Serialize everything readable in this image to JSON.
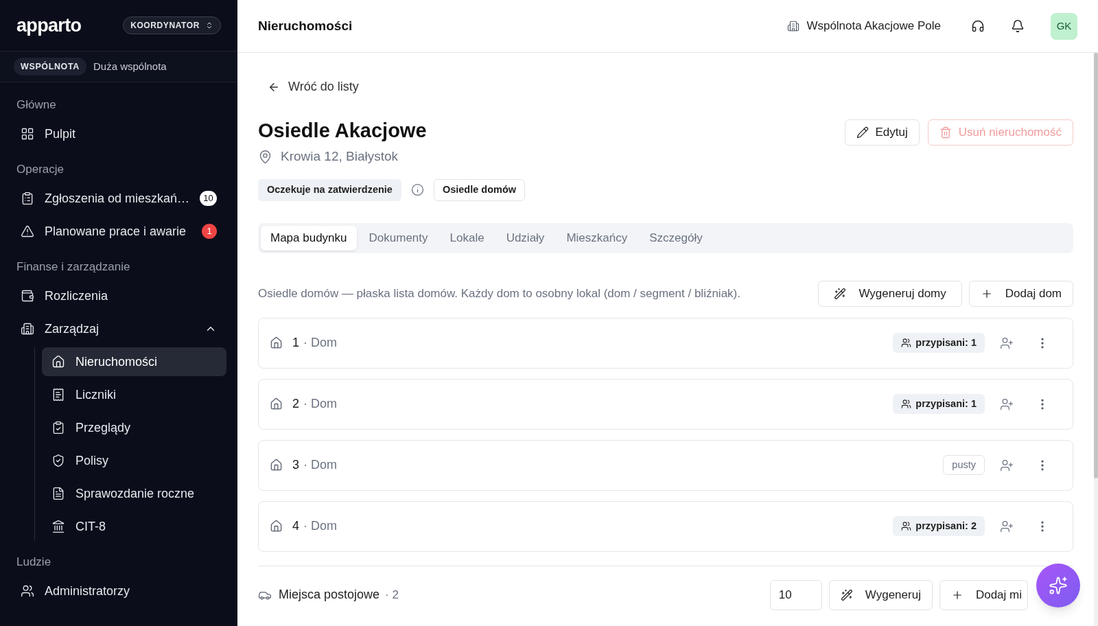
{
  "sidebar": {
    "logo": "apparto",
    "role": "KOORDYNATOR",
    "community_tag": "WSPÓLNOTA",
    "community_name": "Duża wspólnota",
    "sections": [
      {
        "title": "Główne",
        "items": [
          {
            "label": "Pulpit",
            "selected": false
          }
        ]
      },
      {
        "title": "Operacje",
        "items": [
          {
            "label": "Zgłoszenia od mieszkań…",
            "selected": false,
            "badge": "10",
            "color": "#ffffff"
          },
          {
            "label": "Planowane prace i awarie",
            "selected": false,
            "badge": "1",
            "color": "#ef4444"
          }
        ]
      },
      {
        "title": "Finanse i zarządzanie",
        "items": [
          {
            "label": "Rozliczenia",
            "selected": false
          },
          {
            "label": "Zarządzaj",
            "selected": false,
            "expanded": true,
            "children": [
              {
                "label": "Nieruchomości",
                "selected": true
              },
              {
                "label": "Liczniki",
                "selected": false
              },
              {
                "label": "Przeglądy",
                "selected": false
              },
              {
                "label": "Polisy",
                "selected": false
              },
              {
                "label": "Sprawozdanie roczne",
                "selected": false
              },
              {
                "label": "CIT-8",
                "selected": false
              }
            ]
          }
        ]
      },
      {
        "title": "Ludzie",
        "items": [
          {
            "label": "Administratorzy",
            "selected": false
          }
        ]
      }
    ]
  },
  "header": {
    "title": "Nieruchomości",
    "community": "Wspólnota Akacjowe Pole",
    "avatar": "GK"
  },
  "back_link": "Wróć do listy",
  "property": {
    "name": "Osiedle Akacjowe",
    "address": "Krowia 12, Białystok",
    "status": "Oczekuje na zatwierdzenie",
    "type": "Osiedle domów"
  },
  "actions": {
    "edit": "Edytuj",
    "delete": "Usuń nieruchomość"
  },
  "tabs": [
    {
      "label": "Mapa budynku",
      "selected": true
    },
    {
      "label": "Dokumenty",
      "selected": false
    },
    {
      "label": "Lokale",
      "selected": false
    },
    {
      "label": "Udziały",
      "selected": false
    },
    {
      "label": "Mieszkańcy",
      "selected": false
    },
    {
      "label": "Szczegóły",
      "selected": false
    }
  ],
  "description": "Osiedle domów — płaska lista domów. Każdy dom to osobny lokal (dom / segment / bliźniak).",
  "list_buttons": {
    "generate": "Wygeneruj domy",
    "add": "Dodaj dom"
  },
  "houses": [
    {
      "number": "1",
      "type": "· Dom",
      "kind": "assigned",
      "tag": "przypisani: 1"
    },
    {
      "number": "2",
      "type": "· Dom",
      "kind": "assigned",
      "tag": "przypisani: 1"
    },
    {
      "number": "3",
      "type": "· Dom",
      "kind": "empty",
      "tag": "pusty"
    },
    {
      "number": "4",
      "type": "· Dom",
      "kind": "assigned",
      "tag": "przypisani: 2"
    }
  ],
  "parking": {
    "title": "Miejsca postojowe",
    "count": "· 2",
    "quantity": "10",
    "generate": "Wygeneruj",
    "add": "Dodaj mi"
  }
}
